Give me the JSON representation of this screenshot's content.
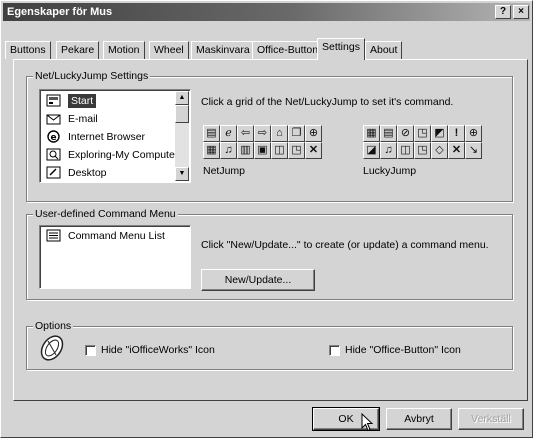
{
  "window": {
    "title": "Egenskaper för Mus",
    "help_btn": "?",
    "close_btn": "×"
  },
  "tabs": [
    "Buttons",
    "Pekare",
    "Motion",
    "Wheel",
    "Maskinvara",
    "Office-Button",
    "Settings",
    "About"
  ],
  "active_tab": "Settings",
  "netlucky": {
    "group_label": "Net/LuckyJump Settings",
    "items": [
      "Start",
      "E-mail",
      "Internet Browser",
      "Exploring-My Computer",
      "Desktop"
    ],
    "selected": "Start",
    "hint": "Click a grid of the Net/LuckyJump to set it's command.",
    "netjump_label": "NetJump",
    "luckyjump_label": "LuckyJump",
    "netjump_icons": [
      "app-icon",
      "browser-icon",
      "arrow-left-icon",
      "arrow-right-icon",
      "home-icon",
      "page-icon",
      "target-icon",
      "app2-icon",
      "sound-icon",
      "form-icon",
      "calc-icon",
      "window-icon",
      "search-icon",
      "close-x-icon"
    ],
    "luckyjump_icons": [
      "app-icon",
      "doc-icon",
      "clip-icon",
      "search-icon",
      "edit-icon",
      "exclaim-icon",
      "target-icon",
      "folder-icon",
      "sound-icon",
      "window-icon",
      "search-icon",
      "eraser-icon",
      "close-x-icon",
      "resize-icon"
    ]
  },
  "command_menu": {
    "group_label": "User-defined Command Menu",
    "list_item": "Command Menu List",
    "hint": "Click \"New/Update...\" to create (or update) a command menu.",
    "new_update": "New/Update..."
  },
  "options": {
    "group_label": "Options",
    "hide_iofficeworks": "Hide \"iOfficeWorks\" Icon",
    "hide_officebutton": "Hide \"Office-Button\" Icon"
  },
  "footer": {
    "ok": "OK",
    "cancel": "Avbryt",
    "apply": "Verkställ"
  },
  "colors": {
    "selection": "#3a3a3a",
    "title_start": "#404040",
    "face": "#d4d4d4"
  }
}
